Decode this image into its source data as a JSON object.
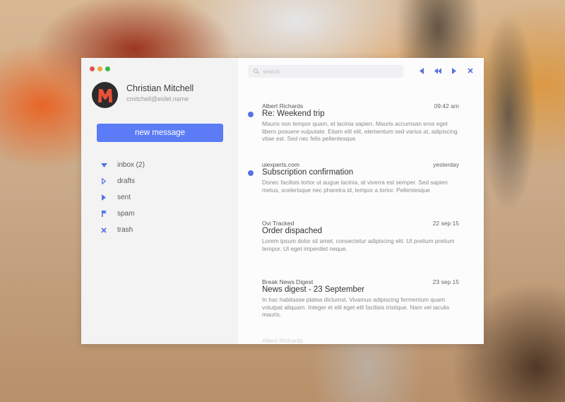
{
  "window": {
    "traffic_lights": [
      "close",
      "minimize",
      "maximize"
    ]
  },
  "profile": {
    "name": "Christian Mitchell",
    "email": "cmitchell@eidel.name",
    "avatar_letter": "M"
  },
  "sidebar": {
    "new_message_label": "new message",
    "folders": [
      {
        "label": "inbox (2)",
        "icon": "triangle-down-icon"
      },
      {
        "label": "drafts",
        "icon": "triangle-right-outline-icon"
      },
      {
        "label": "sent",
        "icon": "triangle-right-icon"
      },
      {
        "label": "spam",
        "icon": "flag-icon"
      },
      {
        "label": "trash",
        "icon": "x-icon"
      }
    ]
  },
  "toolbar": {
    "search_placeholder": "search",
    "search_value": "",
    "icons": [
      "reply-icon",
      "reply-all-icon",
      "forward-icon",
      "close-icon"
    ]
  },
  "messages": [
    {
      "sender": "Albert Richards",
      "time": "09:42 am",
      "subject": "Re: Weekend trip",
      "preview": "Mauris non tempor quam, et lacinia sapien. Mauris accumsan eros eget libero posuere vulputate. Etiam elit elit, elementum sed varius at, adipiscing vitae est. Sed nec felis pellentesque",
      "unread": true
    },
    {
      "sender": "uiexperts.com",
      "time": "yesterday",
      "subject": "Subscription confirmation",
      "preview": "Donec facilisis tortor ut augue lacinia, at viverra est semper. Sed sapien metus, scelerisque nec pharetra id, tempor a tortor. Pellentesque",
      "unread": true
    },
    {
      "sender": "Ovi Tracked",
      "time": "22 sep 15",
      "subject": "Order dispached",
      "preview": "Lorem ipsum dolor sit amet, consectetur adipiscing elit. Ut pretium pretium tempor. Ut eget imperdiet neque.",
      "unread": false
    },
    {
      "sender": "Break News Digest",
      "time": "23 sep 15",
      "subject": "News digest - 23 September",
      "preview": "In hac habitasse platea dictumst. Vivamus adipiscing fermentum quam volutpat aliquam. Integer et elit eget elit facilisis tristique. Nam vel iaculis mauris.",
      "unread": false
    },
    {
      "sender": "Albert Richards",
      "time": "",
      "subject": "",
      "preview": "",
      "unread": false
    }
  ],
  "colors": {
    "accent": "#5b7cf6",
    "unread_dot": "#5673e2",
    "icon_blue": "#5673e2",
    "avatar_bg": "#2e2b2b",
    "avatar_letter": "#e8503a"
  }
}
